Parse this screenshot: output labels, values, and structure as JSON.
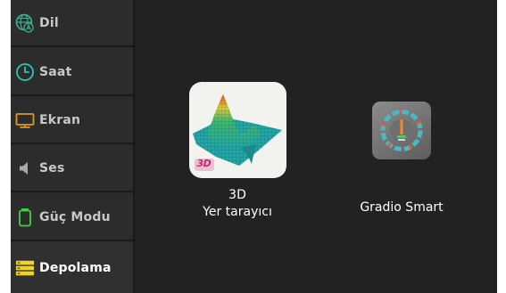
{
  "sidebar": {
    "items": [
      {
        "label": "Dil",
        "icon": "globe-language-icon",
        "color": "#3fae8f"
      },
      {
        "label": "Saat",
        "icon": "clock-icon",
        "color": "#2cc6b0"
      },
      {
        "label": "Ekran",
        "icon": "monitor-icon",
        "color": "#d99a21"
      },
      {
        "label": "Ses",
        "icon": "speaker-icon",
        "color": "#aaaaaa"
      },
      {
        "label": "Güç Modu",
        "icon": "battery-icon",
        "color": "#3fd23f"
      },
      {
        "label": "Depolama",
        "icon": "storage-icon",
        "color": "#f2d21a",
        "active": true
      }
    ]
  },
  "apps": [
    {
      "line1": "3D",
      "line2": "Yer tarayıcı",
      "icon": "3d-ground-scanner-icon",
      "badge": "3D"
    },
    {
      "label": "Gradio Smart",
      "icon": "gradio-smart-icon"
    }
  ],
  "colors": {
    "background": "#222222",
    "sidebar": "#2c2c2c",
    "text": "#ffffff"
  }
}
